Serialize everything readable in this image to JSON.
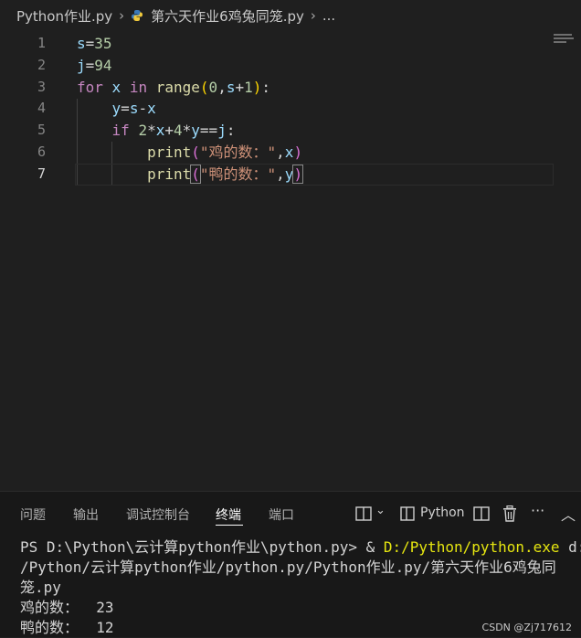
{
  "breadcrumb": {
    "folder": "Python作业.py",
    "file": "第六天作业6鸡兔同笼.py",
    "more": "..."
  },
  "editor": {
    "line_numbers": [
      "1",
      "2",
      "3",
      "4",
      "5",
      "6",
      "7"
    ],
    "lines": [
      "s=35",
      "j=94",
      "for x in range(0,s+1):",
      "    y=s-x",
      "    if 2*x+4*y==j:",
      "        print(\"鸡的数：\",x)",
      "        print(\"鸭的数：\",y)"
    ],
    "tokens": {
      "s": "s",
      "eq": "=",
      "n35": "35",
      "j": "j",
      "n94": "94",
      "for": "for",
      "x": "x",
      "in": "in",
      "range": "range",
      "lp": "(",
      "n0": "0",
      "comma": ",",
      "plus": "+",
      "n1": "1",
      "rp": ")",
      "colon": ":",
      "y": "y",
      "minus": "-",
      "if": "if",
      "n2": "2",
      "star": "*",
      "n4": "4",
      "eqeq": "==",
      "print": "print",
      "str_chicken": "\"鸡的数：\"",
      "str_duck": "\"鸭的数：\""
    }
  },
  "panel": {
    "tabs": [
      "问题",
      "输出",
      "调试控制台",
      "终端",
      "端口"
    ],
    "active_tab": "终端",
    "terminal_profile": "Python",
    "terminal_lines": [
      "PS D:\\Python\\云计算python作业\\python.py> & ",
      "D:/Python/python.exe",
      " d:",
      "/Python/云计算python作业/python.py/Python作业.py/第六天作业6鸡兔同",
      "笼.py",
      "鸡的数：  23",
      "鸭的数：  12"
    ]
  },
  "watermark": "CSDN @Zj717612",
  "colors": {
    "background": "#1f1f1f",
    "keyword": "#c586c0",
    "variable": "#9cdcfe",
    "number": "#b5cea8",
    "function": "#dcdcaa",
    "string": "#ce9178",
    "terminal_path": "#e5e510"
  }
}
